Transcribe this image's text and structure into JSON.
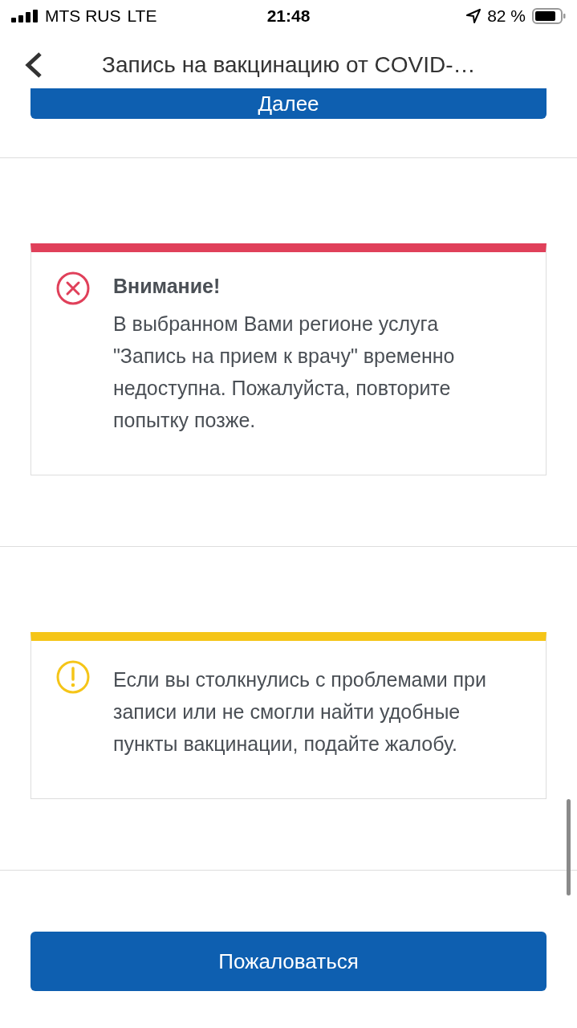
{
  "status_bar": {
    "carrier": "MTS RUS",
    "network": "LTE",
    "time": "21:48",
    "battery": "82 %"
  },
  "header": {
    "title": "Запись на вакцинацию от COVID-…"
  },
  "next_button": {
    "label": "Далее"
  },
  "alerts": [
    {
      "kind": "error",
      "title": "Внимание!",
      "text": "В выбранном Вами регионе услуга \"Запись на прием к врачу\" временно недоступна. Пожалуйста, повторите попытку позже."
    },
    {
      "kind": "warning",
      "text": "Если вы столкнулись с проблемами при записи или не смогли найти удобные пункты вакцинации, подайте жалобу."
    }
  ],
  "complain_button": {
    "label": "Пожаловаться"
  }
}
